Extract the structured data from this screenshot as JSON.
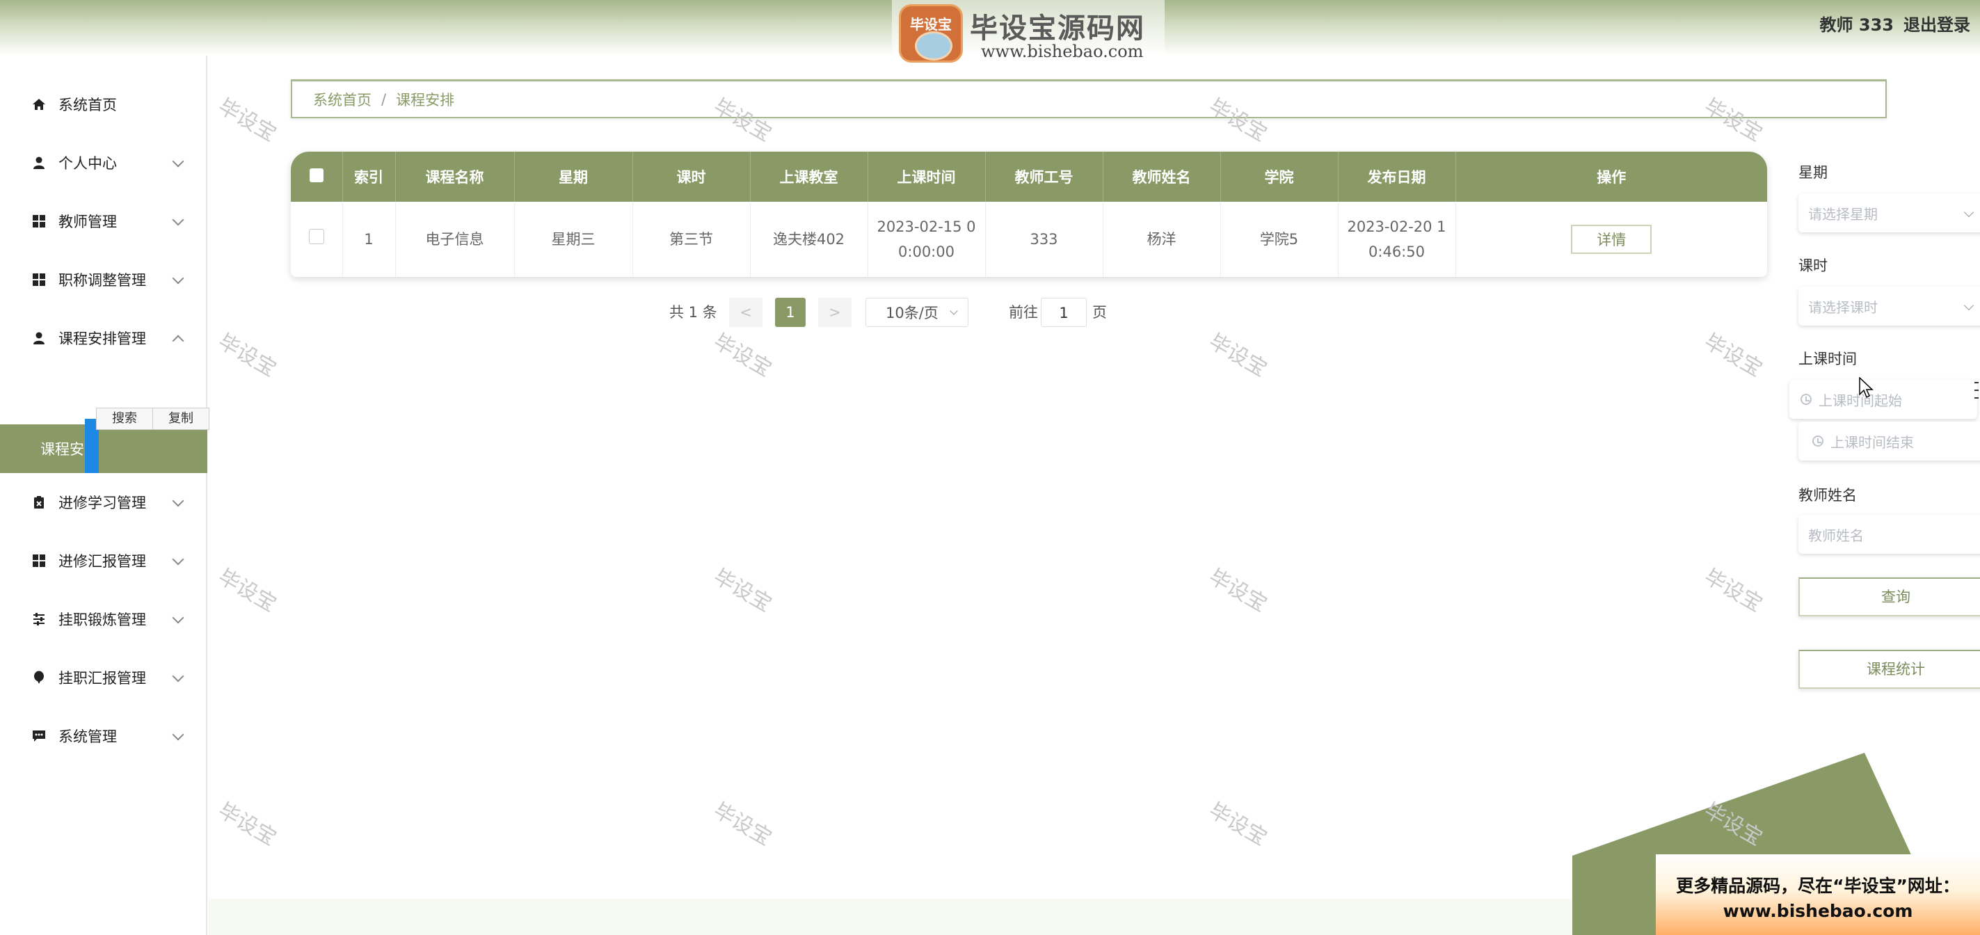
{
  "header": {
    "logo_badge_text": "毕设宝",
    "logo_title": "毕设宝源码网",
    "logo_url": "www.bishebao.com",
    "user_label": "教师 333",
    "logout_label": "退出登录"
  },
  "sidebar": {
    "items": [
      {
        "label": "系统首页",
        "icon": "home-icon"
      },
      {
        "label": "个人中心",
        "icon": "person-icon"
      },
      {
        "label": "教师管理",
        "icon": "grid-icon"
      },
      {
        "label": "职称调整管理",
        "icon": "grid-icon"
      },
      {
        "label": "课程安排管理",
        "icon": "person-icon"
      },
      {
        "label": "进修学习管理",
        "icon": "clipboard-icon"
      },
      {
        "label": "进修汇报管理",
        "icon": "grid-icon"
      },
      {
        "label": "挂职锻炼管理",
        "icon": "sliders-icon"
      },
      {
        "label": "挂职汇报管理",
        "icon": "balloon-icon"
      },
      {
        "label": "系统管理",
        "icon": "chat-icon"
      }
    ],
    "active_sub": "课程安排",
    "context_menu": {
      "search": "搜索",
      "copy": "复制"
    }
  },
  "breadcrumb": {
    "home": "系统首页",
    "separator": "/",
    "current": "课程安排"
  },
  "table": {
    "headers": [
      "索引",
      "课程名称",
      "星期",
      "课时",
      "上课教室",
      "上课时间",
      "教师工号",
      "教师姓名",
      "学院",
      "发布日期",
      "操作"
    ],
    "rows": [
      {
        "index": "1",
        "course": "电子信息",
        "weekday": "星期三",
        "period": "第三节",
        "room": "逸夫楼402",
        "time_line1": "2023-02-15 0",
        "time_line2": "0:00:00",
        "teacher_id": "333",
        "teacher_name": "杨洋",
        "college": "学院5",
        "date_line1": "2023-02-20 1",
        "date_line2": "0:46:50",
        "action": "详情"
      }
    ]
  },
  "pagination": {
    "total": "共 1 条",
    "prev": "<",
    "current": "1",
    "next": ">",
    "page_size": "10条/页",
    "goto_prefix": "前往",
    "goto_value": "1",
    "goto_suffix": "页"
  },
  "filters": {
    "weekday_label": "星期",
    "weekday_placeholder": "请选择星期",
    "period_label": "课时",
    "period_placeholder": "请选择课时",
    "time_label": "上课时间",
    "time_start_placeholder": "上课时间起始",
    "time_end_placeholder": "上课时间结束",
    "teacher_label": "教师姓名",
    "teacher_placeholder": "教师姓名",
    "query_button": "查询",
    "stats_button": "课程统计"
  },
  "watermark_text": "毕设宝",
  "promo": {
    "line1": "更多精品源码，尽在“毕设宝”网址：",
    "line2": "www.bishebao.com"
  },
  "colors": {
    "primary": "#8a9a67",
    "header_top": "#a7b78b",
    "promo_orange": "#ffb067",
    "marker_blue": "#1e88e5"
  }
}
